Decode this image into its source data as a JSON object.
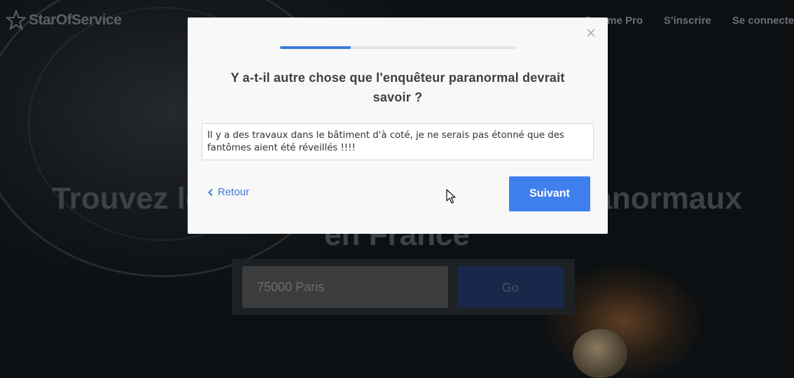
{
  "background": {
    "logo_text": "StarOfService",
    "nav": [
      "Comme Pro",
      "S'inscrire",
      "Se connecter"
    ],
    "hero_line1": "Trouvez les meilleurs enquêteurs paranormaux",
    "hero_line2": "en France",
    "search_value": "75000 Paris",
    "search_button": "Go"
  },
  "modal": {
    "progress_percent": 30,
    "question": "Y a-t-il autre chose que l'enquêteur paranormal devrait savoir ?",
    "answer": "Il y a des travaux dans le bâtiment d'à coté, je ne serais pas étonné que des fantômes aient été réveillés !!!!",
    "back_label": "Retour",
    "next_label": "Suivant"
  },
  "colors": {
    "accent": "#3f80ee",
    "progress": "#3d7bdc",
    "link": "#3d7bdc"
  }
}
